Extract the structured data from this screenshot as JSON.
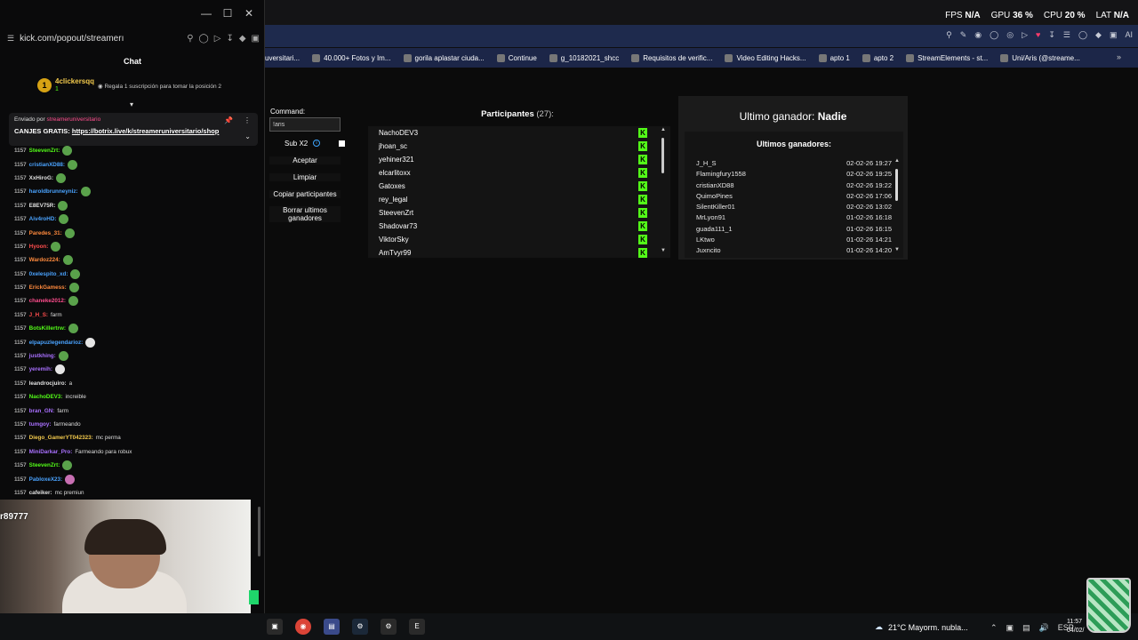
{
  "popup": {
    "url": "kick.com/popout/streamerı",
    "chat_title": "Chat",
    "sub_user": "4clickersqq",
    "sub_user_num": "1",
    "sub_badge": "1",
    "sub_gift_text": "Regala 1 suscripción para tomar la posición 2",
    "pinned_by": "Enviado por",
    "pinned_user": "streameruniversitario",
    "pinned_text": "CANJES GRATIS:",
    "pinned_link": "https://botrix.live/k/streameruniversitario/shop"
  },
  "chat": [
    {
      "time": "1157",
      "user": "SteevenZrt:",
      "color": "#53fc18",
      "msg": "",
      "emote": "frog"
    },
    {
      "time": "1157",
      "user": "cristianXD88:",
      "color": "#4aa3ff",
      "msg": "",
      "emote": "frog"
    },
    {
      "time": "1157",
      "user": "XxHiroG:",
      "color": "#e0e0e0",
      "msg": "",
      "emote": "frog"
    },
    {
      "time": "1157",
      "user": "haroldbrunneyniz:",
      "color": "#4aa3ff",
      "msg": "",
      "emote": "frog"
    },
    {
      "time": "1157",
      "user": "E8EV75R:",
      "color": "#e0e0e0",
      "msg": "",
      "emote": "frog"
    },
    {
      "time": "1157",
      "user": "Aiv4roHD:",
      "color": "#4aa3ff",
      "msg": "",
      "emote": "frog"
    },
    {
      "time": "1157",
      "user": "Paredes_31:",
      "color": "#ff8a3d",
      "msg": "",
      "emote": "frog"
    },
    {
      "time": "1157",
      "user": "Hyoon:",
      "color": "#ff4d4d",
      "msg": "",
      "emote": "frog"
    },
    {
      "time": "1157",
      "user": "Wardoz224:",
      "color": "#ff8a3d",
      "msg": "",
      "emote": "frog"
    },
    {
      "time": "1157",
      "user": "0xelespito_xd:",
      "color": "#4aa3ff",
      "msg": "",
      "emote": "frog"
    },
    {
      "time": "1157",
      "user": "ErickGamess:",
      "color": "#ff8a3d",
      "msg": "",
      "emote": "frog"
    },
    {
      "time": "1157",
      "user": "chaneke2012:",
      "color": "#ff4d8d",
      "msg": "",
      "emote": "frog"
    },
    {
      "time": "1157",
      "user": "J_H_S:",
      "color": "#ff4d4d",
      "msg": "farm",
      "emote": ""
    },
    {
      "time": "1157",
      "user": "BotsKillertrw:",
      "color": "#53fc18",
      "msg": "",
      "emote": "frog"
    },
    {
      "time": "1157",
      "user": "elpapuzlegendarioz:",
      "color": "#4aa3ff",
      "msg": "",
      "emote": "ghost"
    },
    {
      "time": "1157",
      "user": "justkhing:",
      "color": "#a970ff",
      "msg": "",
      "emote": "frog"
    },
    {
      "time": "1157",
      "user": "yeremih:",
      "color": "#a970ff",
      "msg": "",
      "emote": "ghost"
    },
    {
      "time": "1157",
      "user": "leandrocjuiro:",
      "color": "#e0e0e0",
      "msg": "a",
      "emote": ""
    },
    {
      "time": "1157",
      "user": "NachoDEV3:",
      "color": "#53fc18",
      "msg": "increible",
      "emote": ""
    },
    {
      "time": "1157",
      "user": "bran_GN:",
      "color": "#a970ff",
      "msg": "farm",
      "emote": ""
    },
    {
      "time": "1157",
      "user": "tumgoy:",
      "color": "#a970ff",
      "msg": "farmeando",
      "emote": ""
    },
    {
      "time": "1157",
      "user": "Diego_GamerYT042323:",
      "color": "#f2c94c",
      "msg": "mc perma",
      "emote": ""
    },
    {
      "time": "1157",
      "user": "MiniDarkar_Pro:",
      "color": "#a970ff",
      "msg": "Farmeando para robux",
      "emote": ""
    },
    {
      "time": "1157",
      "user": "SteevenZrt:",
      "color": "#53fc18",
      "msg": "",
      "emote": "frog"
    },
    {
      "time": "1157",
      "user": "PabloxeX23:",
      "color": "#4aa3ff",
      "msg": "",
      "emote": "pink"
    },
    {
      "time": "1157",
      "user": "cafeiker:",
      "color": "#e0e0e0",
      "msg": "mc premiun",
      "emote": ""
    }
  ],
  "webcam": {
    "overlay_name": "r89777"
  },
  "stats": {
    "fps_label": "FPS",
    "fps_value": "N/A",
    "gpu_label": "GPU",
    "gpu_value": "36 %",
    "cpu_label": "CPU",
    "cpu_value": "20 %",
    "lat_label": "LAT",
    "lat_value": "N/A"
  },
  "toolbar": {
    "ai_label": "AI"
  },
  "bookmarks": [
    {
      "label": "uversitari..."
    },
    {
      "label": "40.000+ Fotos y Im..."
    },
    {
      "label": "gorila aplastar ciuda..."
    },
    {
      "label": "Continue"
    },
    {
      "label": "g_10182021_shcc"
    },
    {
      "label": "Requisitos de verific..."
    },
    {
      "label": "Video Editing Hacks..."
    },
    {
      "label": "apto 1"
    },
    {
      "label": "apto 2"
    },
    {
      "label": "StreamElements - st..."
    },
    {
      "label": "Uni/Aris (@streame..."
    }
  ],
  "command": {
    "label": "Command:",
    "value": "!aris",
    "sub_x2": "Sub X2",
    "accept": "Aceptar",
    "clear": "Limpiar",
    "copy": "Copiar participantes",
    "delete_winners": "Borrar ultimos ganadores"
  },
  "participants": {
    "title": "Participantes",
    "count": "(27):",
    "kick_glyph": "K",
    "names": [
      "NachoDEV3",
      "jhoan_sc",
      "yehiner321",
      "elcarlitoxx",
      "Gatoxes",
      "rey_legal",
      "SteevenZrt",
      "Shadovar73",
      "ViktorSky",
      "AmTvyr99"
    ]
  },
  "winners": {
    "last_label": "Ultimo ganador:",
    "last_value": "Nadie",
    "list_title": "Ultimos ganadores:",
    "rows": [
      {
        "name": "J_H_S",
        "date": "02-02-26 19:27"
      },
      {
        "name": "Flamingfury1558",
        "date": "02-02-26 19:25"
      },
      {
        "name": "cristianXD88",
        "date": "02-02-26 19:22"
      },
      {
        "name": "QuimoPines",
        "date": "02-02-26 17:06"
      },
      {
        "name": "SilentKiller01",
        "date": "02-02-26 13:02"
      },
      {
        "name": "MrLyon91",
        "date": "01-02-26 16:18"
      },
      {
        "name": "guada111_1",
        "date": "01-02-26 16:15"
      },
      {
        "name": "LKtwo",
        "date": "01-02-26 14:21"
      },
      {
        "name": "Juxncito",
        "date": "01-02-26 14:20"
      }
    ]
  },
  "taskbar": {
    "weather": "21°C  Mayorm. nubla...",
    "lang": "ESP",
    "time": "11:57",
    "date": "04/02/"
  },
  "colors": {
    "kick_green": "#53fc18",
    "toolbar_blue": "#1e2a4d"
  }
}
